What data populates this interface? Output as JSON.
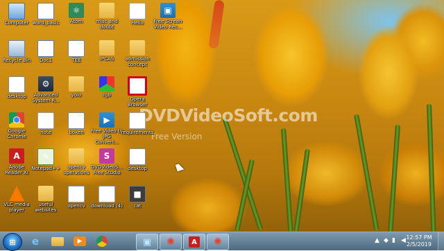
{
  "watermark": {
    "text": "DVDVideoSoft.com",
    "subtext": "Free Version"
  },
  "desktop_icons": [
    {
      "label": "Computer",
      "icon": "computer-icon"
    },
    {
      "label": "word_basic",
      "icon": "word-doc-icon"
    },
    {
      "label": "Atom",
      "icon": "atom-icon"
    },
    {
      "label": "misc and doubt",
      "icon": "folder-icon"
    },
    {
      "label": "Hello",
      "icon": "file-icon"
    },
    {
      "label": "Free Screen Video Rec...",
      "icon": "dvdvideosoft-icon"
    },
    {
      "label": "Recycle Bin",
      "icon": "recycle-bin-icon"
    },
    {
      "label": "Doc1",
      "icon": "word-doc-icon"
    },
    {
      "label": "TEE",
      "icon": "text-file-icon"
    },
    {
      "label": "IPCAS",
      "icon": "folder-icon"
    },
    {
      "label": "admission concept",
      "icon": "folder-icon"
    },
    {
      "label": "desktop",
      "icon": "python-file-icon"
    },
    {
      "label": "Advanced System R...",
      "icon": "antivirus-icon"
    },
    {
      "label": "yolo",
      "icon": "folder-icon"
    },
    {
      "label": "rgb",
      "icon": "rgb-icon"
    },
    {
      "label": "Opera Browser",
      "icon": "opera-icon"
    },
    {
      "label": "Google Chrome",
      "icon": "chrome-icon"
    },
    {
      "label": "note",
      "icon": "file-icon"
    },
    {
      "label": "bokeh",
      "icon": "dots-file-icon"
    },
    {
      "label": "Free Video to JPG Convert...",
      "icon": "dvdvideosoft-icon"
    },
    {
      "label": "requirements",
      "icon": "file-icon"
    },
    {
      "label": "Adobe Reader XI",
      "icon": "pdf-icon"
    },
    {
      "label": "Notepad++",
      "icon": "notepad-plus-icon"
    },
    {
      "label": "opencv operations",
      "icon": "folder-icon"
    },
    {
      "label": "DVDVideoS... Free Studio",
      "icon": "free-studio-icon"
    },
    {
      "label": "desktop",
      "icon": "python-file-icon"
    },
    {
      "label": "VLC media player",
      "icon": "vlc-icon"
    },
    {
      "label": "useful websites",
      "icon": "folder-icon"
    },
    {
      "label": "opencv",
      "icon": "file-icon"
    },
    {
      "label": "download (4)",
      "icon": "image-icon"
    },
    {
      "label": "cat",
      "icon": "exe-icon"
    }
  ],
  "taskbar": {
    "start_label": "Start",
    "pinned": [
      {
        "name": "ie-taskbar-button",
        "icon": "ie-icon",
        "glyph": "e"
      },
      {
        "name": "explorer-taskbar-button",
        "icon": "folder-icon",
        "glyph": ""
      },
      {
        "name": "media-player-taskbar-button",
        "icon": "play-icon",
        "glyph": "▶"
      },
      {
        "name": "chrome-taskbar-button",
        "icon": "chrome-icon",
        "glyph": ""
      },
      {
        "name": "screen-recorder-taskbar-button",
        "icon": "screen-recorder-icon",
        "glyph": "▣"
      },
      {
        "name": "settings-app-taskbar-button",
        "icon": "gear-icon",
        "glyph": "✺"
      },
      {
        "name": "adobe-reader-taskbar-button",
        "icon": "pdf-icon",
        "glyph": "A"
      },
      {
        "name": "gear-app-taskbar-button",
        "icon": "gear-icon",
        "glyph": "✺"
      }
    ],
    "time": "12:57 PM",
    "date": "2/5/2019"
  }
}
